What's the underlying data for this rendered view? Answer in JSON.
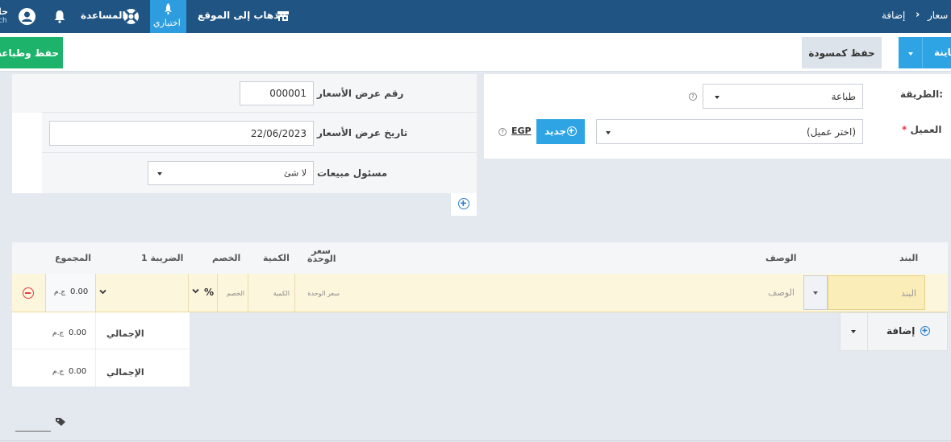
{
  "topbar": {
    "breadcrumb_parent": "سعار",
    "breadcrumb_separator": "›",
    "breadcrumb_current": "إضافة",
    "goto_site_label": "الذهاب إلى الموقع",
    "trial_label": "اختياري",
    "help_label": "المساعدة",
    "user_line1": "حا",
    "user_line2": "ch"
  },
  "actions": {
    "save_print_label": "حفظ وطباعة",
    "save_draft_label": "حفظ كمسودة",
    "primary_label": "كاينة",
    "primary_dropdown": "▾"
  },
  "form": {
    "method_label": "الطريقة:",
    "method_value": "طباعة",
    "client_label": "العميل",
    "client_required": "*",
    "client_placeholder": "(اختر عميل)",
    "new_client_label": "جديد",
    "currency": "EGP",
    "quote_number_label": "رقم عرض الأسعار",
    "quote_number_value": "000001",
    "quote_date_label": "تاريخ عرض الأسعار",
    "quote_date_value": "22/06/2023",
    "sales_rep_label": "مسئول مبيعات",
    "sales_rep_value": "لا شئ"
  },
  "table": {
    "headers": {
      "item": "البند",
      "description": "الوصف",
      "unit_price_line1": "سعر",
      "unit_price_line2": "الوحدة",
      "quantity": "الكمية",
      "discount": "الخصم",
      "tax1": "الضريبة 1",
      "total": "المجموع"
    },
    "row": {
      "item_placeholder": "البند",
      "description_placeholder": "الوصف",
      "unit_price_placeholder": "سعر الوحدة",
      "quantity_placeholder": "الكمية",
      "discount_placeholder": "الخصم",
      "discount_unit": "%",
      "total_value": "0.00",
      "total_currency": "ج.م"
    },
    "add_label": "إضافة",
    "totals": [
      {
        "label": "الإجمالي",
        "value": "0.00",
        "currency": "ج.م"
      },
      {
        "label": "الإجمالي",
        "value": "0.00",
        "currency": "ج.م"
      }
    ]
  },
  "colors": {
    "topbar": "#1f5483",
    "accent_blue": "#2ea4e4",
    "save_green": "#1db36b",
    "remove_red": "#e33b44",
    "row_highlight": "#fcf6dc"
  }
}
